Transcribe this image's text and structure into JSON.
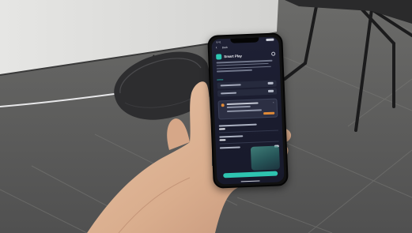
{
  "phone_app": {
    "status_time": "9:41",
    "nav_title": "Back",
    "screen_title": "Smart Play",
    "icons": {
      "back": "chevron-left-icon",
      "settings": "gear-icon",
      "app": "app-icon"
    },
    "accent_color": "#2dc7b2",
    "alert_color": "#e08a37"
  }
}
